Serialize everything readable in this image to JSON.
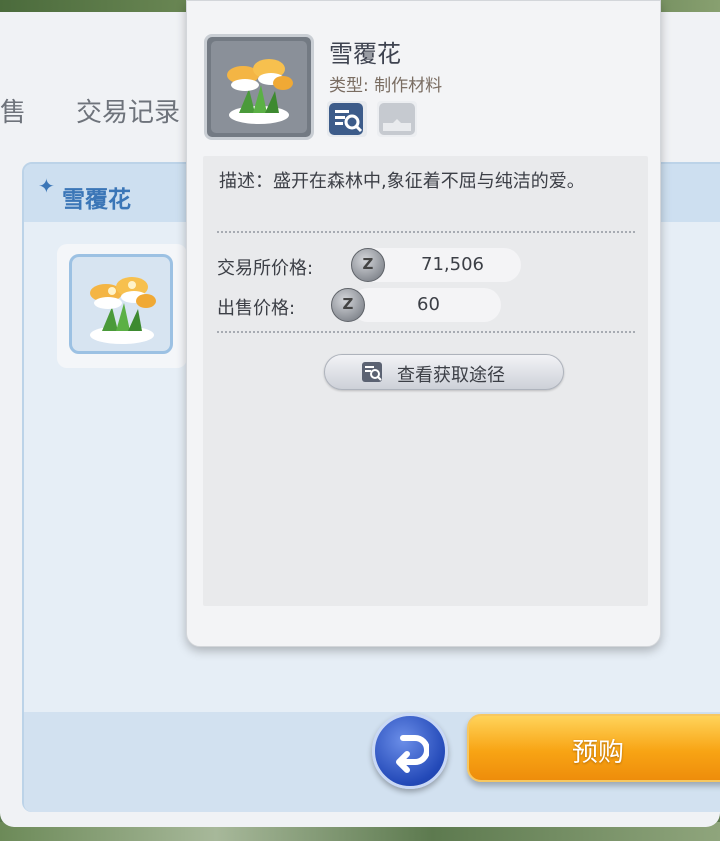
{
  "tabs": {
    "sell": "售",
    "records": "交易记录"
  },
  "item_panel": {
    "title": "雪覆花",
    "sparkle": "✦"
  },
  "tooltip": {
    "name": "雪覆花",
    "type_label": "类型:",
    "type_value": "制作材料",
    "description": "描述：盛开在森林中,象征着不屈与纯洁的爱。",
    "exchange_price_label": "交易所价格:",
    "exchange_price_value": "71,506",
    "sell_price_label": "出售价格:",
    "sell_price_value": "60",
    "coin_symbol": "Z",
    "acquire_button_label": "查看获取途径"
  },
  "buttons": {
    "preorder_label": "预购"
  },
  "colors": {
    "accent_blue": "#3b76b7",
    "preorder_orange": "#f8a414",
    "back_blue": "#2349b8"
  }
}
